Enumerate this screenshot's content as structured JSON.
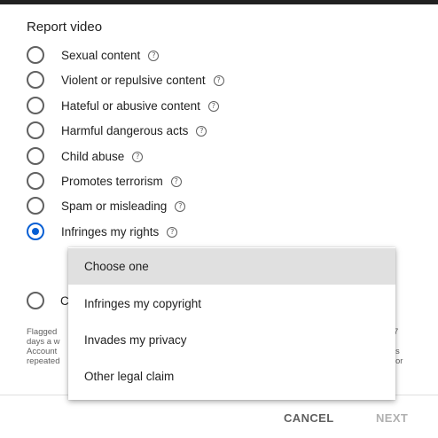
{
  "dialog": {
    "title": "Report video",
    "options": [
      {
        "label": "Sexual content",
        "checked": false
      },
      {
        "label": "Violent or repulsive content",
        "checked": false
      },
      {
        "label": "Hateful or abusive content",
        "checked": false
      },
      {
        "label": "Harmful dangerous acts",
        "checked": false
      },
      {
        "label": "Child abuse",
        "checked": false
      },
      {
        "label": "Promotes terrorism",
        "checked": false
      },
      {
        "label": "Spam or misleading",
        "checked": false
      },
      {
        "label": "Infringes my rights",
        "checked": true
      },
      {
        "label": "C",
        "checked": false
      }
    ],
    "help_glyph": "?",
    "footnote": {
      "lines": [
        "Flagged",
        "days a w",
        "Account",
        "repeated"
      ],
      "right_1": "7",
      "right_2": "s or"
    },
    "cancel_label": "CANCEL",
    "next_label": "NEXT"
  },
  "dropdown": {
    "items": [
      {
        "label": "Choose one",
        "selected": true
      },
      {
        "label": "Infringes my copyright",
        "selected": false
      },
      {
        "label": "Invades my privacy",
        "selected": false
      },
      {
        "label": "Other legal claim",
        "selected": false
      }
    ]
  },
  "colors": {
    "accent": "#065fd4",
    "radio_border": "#616161"
  }
}
